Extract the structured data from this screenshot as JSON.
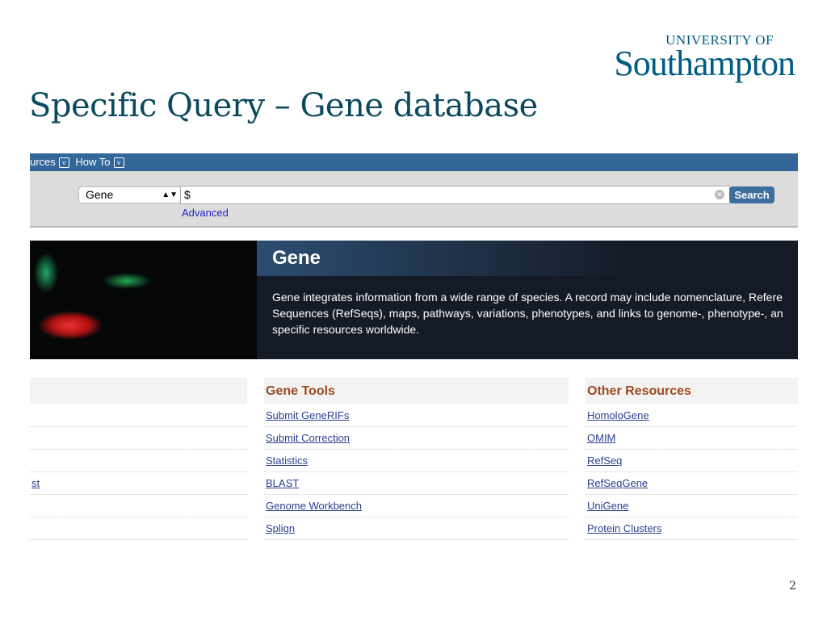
{
  "logo": {
    "line1": "UNIVERSITY OF",
    "line2": "Southampton"
  },
  "slide": {
    "title": "Specific Query – Gene database",
    "page_number": "2"
  },
  "nav": {
    "items": [
      "urces",
      "How To"
    ]
  },
  "search": {
    "database": "Gene",
    "query": "$",
    "search_label": "Search",
    "advanced_label": "Advanced"
  },
  "hero": {
    "title": "Gene",
    "lines": [
      "Gene integrates information from a wide range of species. A record may include nomenclature, Refere",
      "Sequences (RefSeqs), maps, pathways, variations, phenotypes, and links to genome-, phenotype-, an",
      "specific resources worldwide."
    ]
  },
  "left_col": {
    "links": [
      "",
      "",
      "",
      "st",
      "",
      ""
    ]
  },
  "gene_tools": {
    "heading": "Gene Tools",
    "links": [
      "Submit GeneRIFs",
      "Submit Correction",
      "Statistics",
      "BLAST",
      "Genome Workbench",
      "Splign"
    ]
  },
  "other_resources": {
    "heading": "Other Resources",
    "links": [
      "HomoloGene",
      "OMIM",
      "RefSeq",
      "RefSeqGene",
      "UniGene",
      "Protein Clusters"
    ]
  }
}
